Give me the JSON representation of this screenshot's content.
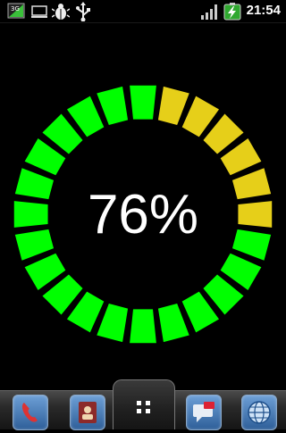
{
  "status_bar": {
    "network_badge": "3G",
    "time": "21:54",
    "icons": [
      "3g-data-icon",
      "screen-icon",
      "bug-debug-icon",
      "usb-icon",
      "signal-strength-icon",
      "battery-charging-icon"
    ]
  },
  "gauge": {
    "percent_text": "76%",
    "level": 0.76,
    "segments": 24,
    "colors": {
      "filled": "#00ff00",
      "empty": "#e6cf19"
    }
  },
  "dock": {
    "items": [
      "phone-icon",
      "contacts-icon",
      "app-drawer-icon",
      "messaging-icon",
      "browser-icon"
    ]
  }
}
